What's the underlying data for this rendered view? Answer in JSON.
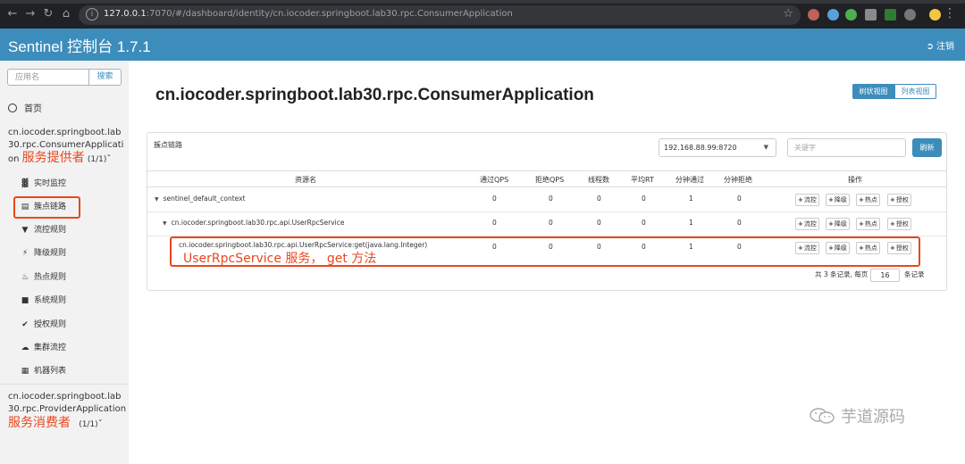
{
  "browser": {
    "url_main": "127.0.0.1",
    "url_rest": ":7070/#/dashboard/identity/cn.iocoder.springboot.lab30.rpc.ConsumerApplication"
  },
  "header": {
    "title": "Sentinel 控制台 1.7.1",
    "logout_label": "注销",
    "accent_color": "#3c8dbc"
  },
  "sidebar": {
    "search_placeholder": "应用名",
    "search_button": "搜索",
    "home_label": "首页",
    "apps": [
      {
        "name_line1": "cn.iocoder.springboot.lab",
        "name_line2": "30.rpc.ConsumerApplicati",
        "name_line3": "on",
        "count": "(1/1)",
        "annotation": "服务提供者"
      },
      {
        "name_line1": "cn.iocoder.springboot.lab",
        "name_line2": "30.rpc.ProviderApplication",
        "count": "(1/1)",
        "annotation": "服务消费者"
      }
    ],
    "items": [
      {
        "label": "实时监控",
        "icon": "bar-chart-icon"
      },
      {
        "label": "簇点链路",
        "icon": "list-icon"
      },
      {
        "label": "流控规则",
        "icon": "filter-icon"
      },
      {
        "label": "降级规则",
        "icon": "flash-icon"
      },
      {
        "label": "热点规则",
        "icon": "fire-icon"
      },
      {
        "label": "系统规则",
        "icon": "lock-icon"
      },
      {
        "label": "授权规则",
        "icon": "check-circle-icon"
      },
      {
        "label": "集群流控",
        "icon": "cloud-icon"
      },
      {
        "label": "机器列表",
        "icon": "table-icon"
      }
    ]
  },
  "main": {
    "title": "cn.iocoder.springboot.lab30.rpc.ConsumerApplication",
    "view_tree": "树状视图",
    "view_list": "列表视图",
    "panel_title": "簇点链路",
    "machine": "192.168.88.99:8720",
    "keyword_placeholder": "关键字",
    "refresh": "刷新",
    "columns": [
      "资源名",
      "通过QPS",
      "拒绝QPS",
      "线程数",
      "平均RT",
      "分钟通过",
      "分钟拒绝",
      "操作"
    ],
    "rows": [
      {
        "name": "sentinel_default_context",
        "pass_qps": "0",
        "block_qps": "0",
        "threads": "0",
        "avg_rt": "0",
        "min_pass": "1",
        "min_block": "0"
      },
      {
        "name": "cn.iocoder.springboot.lab30.rpc.api.UserRpcService",
        "pass_qps": "0",
        "block_qps": "0",
        "threads": "0",
        "avg_rt": "0",
        "min_pass": "1",
        "min_block": "0"
      },
      {
        "name": "cn.iocoder.springboot.lab30.rpc.api.UserRpcService:get(java.lang.Integer)",
        "pass_qps": "0",
        "block_qps": "0",
        "threads": "0",
        "avg_rt": "0",
        "min_pass": "1",
        "min_block": "0"
      }
    ],
    "ops": [
      "流控",
      "降级",
      "热点",
      "授权"
    ],
    "pager_prefix": "共 3 条记录, 每页",
    "page_size": "16",
    "pager_suffix": "条记录",
    "annotation": "UserRpcService 服务， get 方法"
  },
  "watermark": "芋道源码"
}
